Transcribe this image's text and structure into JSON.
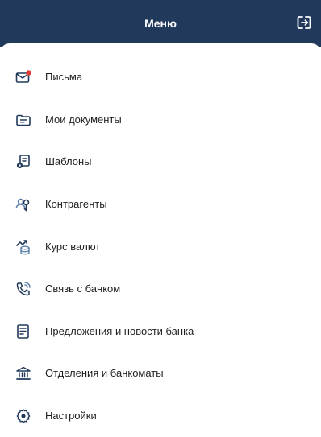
{
  "header": {
    "title": "Меню",
    "logout_icon": "logout-icon",
    "background": "#213a5c"
  },
  "menu": {
    "items": [
      {
        "label": "Письма",
        "icon": "mail-icon",
        "badge_color": "#e53935"
      },
      {
        "label": "Мои документы",
        "icon": "folder-icon"
      },
      {
        "label": "Шаблоны",
        "icon": "template-icon"
      },
      {
        "label": "Контрагенты",
        "icon": "counterparties-icon"
      },
      {
        "label": "Курс валют",
        "icon": "currency-rate-icon"
      },
      {
        "label": "Связь с банком",
        "icon": "phone-icon"
      },
      {
        "label": "Предложения и новости банка",
        "icon": "news-icon"
      },
      {
        "label": "Отделения и банкоматы",
        "icon": "bank-icon"
      },
      {
        "label": "Настройки",
        "icon": "settings-icon"
      }
    ]
  },
  "colors": {
    "accent": "#213a5c",
    "text": "#1f1f1f",
    "badge": "#e53935"
  }
}
